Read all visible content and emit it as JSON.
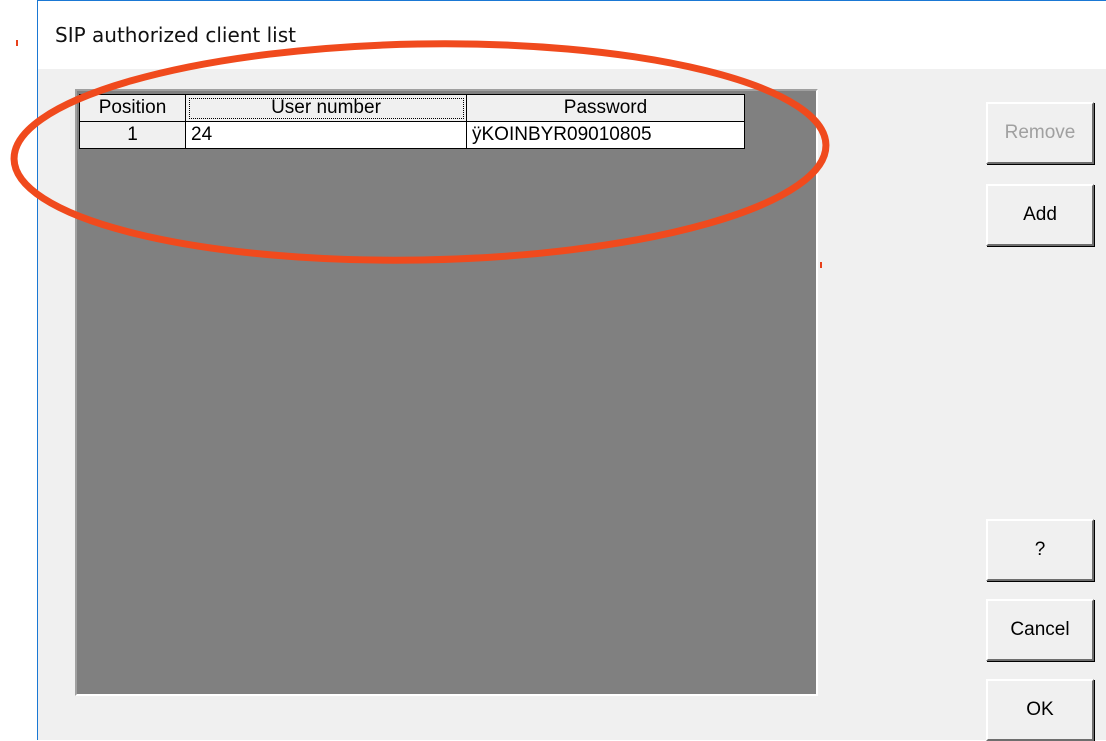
{
  "window": {
    "title": "SIP authorized client list"
  },
  "table": {
    "columns": [
      "Position",
      "User number",
      "Password"
    ],
    "rows": [
      {
        "position": "1",
        "user_number": "24",
        "password": "ÿKOINBYR09010805"
      }
    ]
  },
  "buttons": {
    "remove": "Remove",
    "add": "Add",
    "help": "?",
    "cancel": "Cancel",
    "ok": "OK"
  },
  "colors": {
    "annotation": "#f04a1d",
    "grid_background": "#808080",
    "dialog_background": "#f0f0f0",
    "window_border": "#1a78d4"
  }
}
